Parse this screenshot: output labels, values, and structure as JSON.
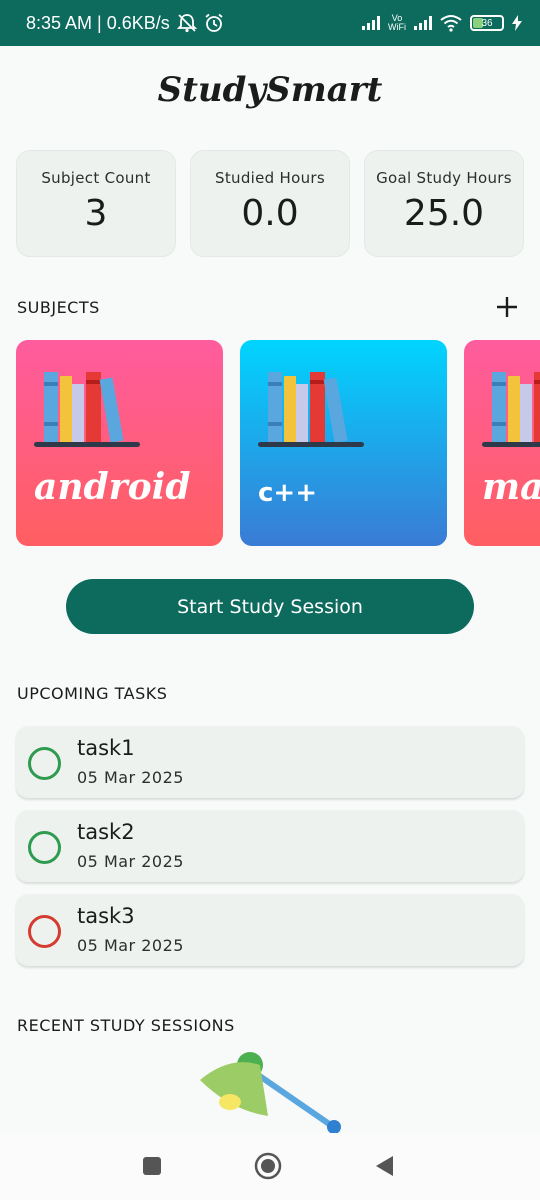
{
  "status_bar": {
    "time_text": "8:35 AM | 0.6KB/s",
    "vo_line1": "Vo",
    "vo_line2": "WiFi",
    "battery_level": "36"
  },
  "app": {
    "title": "StudySmart"
  },
  "stats": [
    {
      "label": "Subject Count",
      "value": "3"
    },
    {
      "label": "Studied Hours",
      "value": "0.0"
    },
    {
      "label": "Goal Study Hours",
      "value": "25.0"
    }
  ],
  "subjects_section": {
    "heading": "SUBJECTS",
    "add_icon": "plus-icon",
    "cards": [
      {
        "name": "android",
        "gradient": [
          "#ff5c9e",
          "#ff5f61"
        ]
      },
      {
        "name": "c++",
        "gradient": [
          "#00d4ff",
          "#3a7bd5"
        ]
      },
      {
        "name": "mat",
        "gradient": [
          "#ff5c9e",
          "#ff5f61"
        ]
      }
    ]
  },
  "start_session": {
    "label": "Start Study Session"
  },
  "tasks_section": {
    "heading": "UPCOMING TASKS",
    "tasks": [
      {
        "title": "task1",
        "date": "05 Mar 2025",
        "priority_color": "#2e9b4f"
      },
      {
        "title": "task2",
        "date": "05 Mar 2025",
        "priority_color": "#2e9b4f"
      },
      {
        "title": "task3",
        "date": "05 Mar 2025",
        "priority_color": "#d63b2f"
      }
    ]
  },
  "sessions_section": {
    "heading": "RECENT STUDY SESSIONS"
  },
  "navigation": {
    "recents_icon": "square-icon",
    "home_icon": "circle-home-icon",
    "back_icon": "triangle-back-icon"
  },
  "colors": {
    "primary": "#0d6b5e",
    "card_bg": "#edf2ef",
    "page_bg": "#f7faf8"
  }
}
